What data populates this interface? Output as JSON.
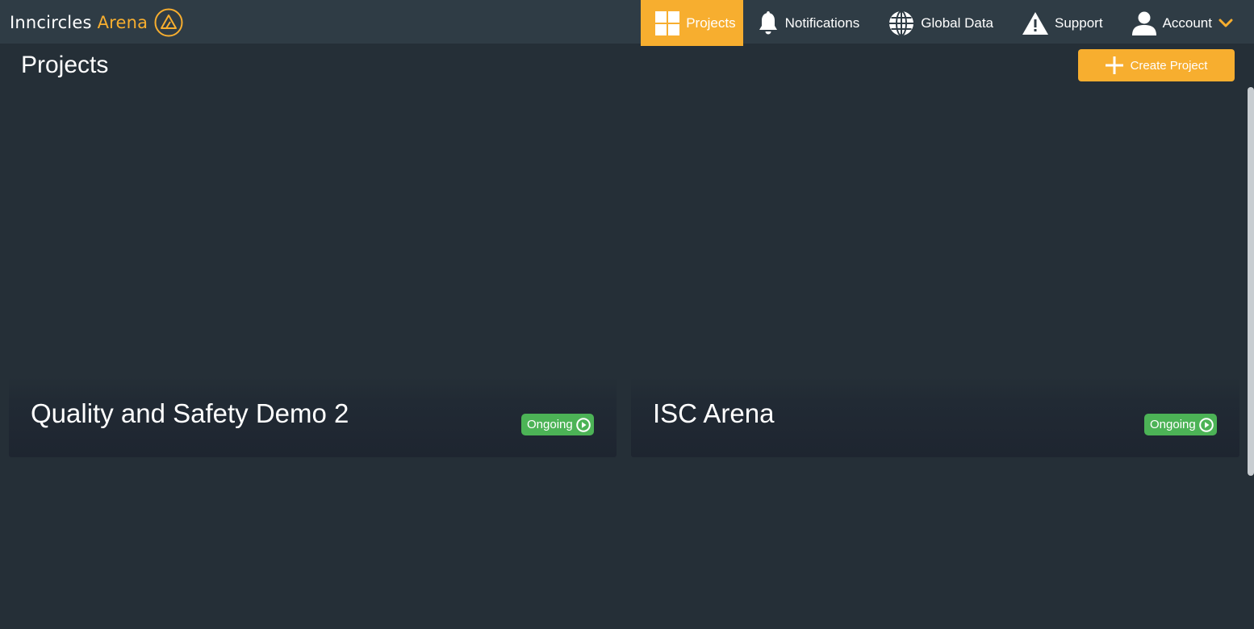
{
  "brand": {
    "name_part1": "Inncircles",
    "name_part2": "Arena",
    "logo_icon": "triangle-logo-icon",
    "accent": "#f7ae2f"
  },
  "nav": {
    "projects": {
      "label": "Projects",
      "icon": "grid-icon"
    },
    "notifications": {
      "label": "Notifications",
      "icon": "bell-icon"
    },
    "global_data": {
      "label": "Global Data",
      "icon": "globe-icon"
    },
    "support": {
      "label": "Support",
      "icon": "warning-icon"
    },
    "account": {
      "label": "Account",
      "icon": "user-icon",
      "menu_icon": "chevron-down-icon"
    }
  },
  "page": {
    "title": "Projects",
    "create_button_label": "Create Project"
  },
  "projects": [
    {
      "name": "Quality and Safety Demo 2",
      "status": "Ongoing",
      "status_icon": "play-circle-icon",
      "status_color": "#4cb356"
    },
    {
      "name": "ISC Arena",
      "status": "Ongoing",
      "status_icon": "play-circle-icon",
      "status_color": "#4cb356"
    }
  ],
  "colors": {
    "topbar": "#2f3c45",
    "background": "#252f37",
    "accent": "#f7ae2f",
    "success": "#4cb356"
  }
}
